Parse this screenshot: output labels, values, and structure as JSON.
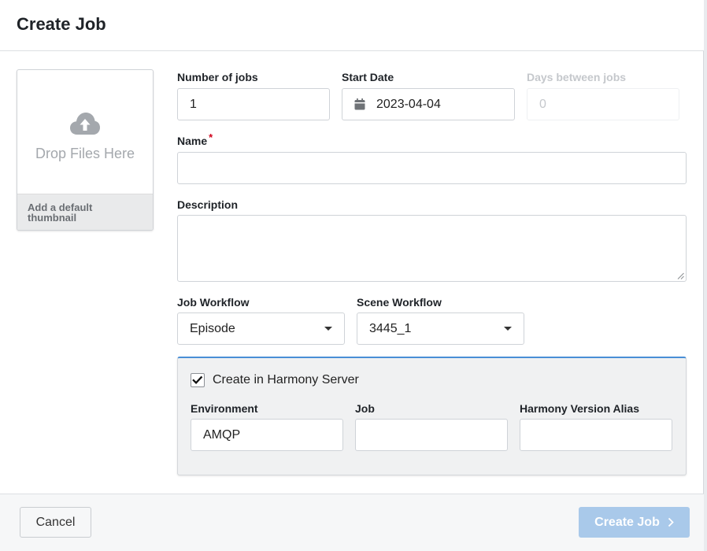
{
  "dialog": {
    "title": "Create Job"
  },
  "thumbnail": {
    "drop_text": "Drop Files Here",
    "default_label": "Add a default thumbnail"
  },
  "form": {
    "num_jobs": {
      "label": "Number of jobs",
      "value": "1"
    },
    "start_date": {
      "label": "Start Date",
      "value": "2023-04-04"
    },
    "days_between": {
      "label": "Days between jobs",
      "placeholder": "0"
    },
    "name": {
      "label": "Name",
      "required_mark": "*",
      "value": ""
    },
    "description": {
      "label": "Description",
      "value": ""
    },
    "job_workflow": {
      "label": "Job Workflow",
      "value": "Episode"
    },
    "scene_workflow": {
      "label": "Scene Workflow",
      "value": "3445_1"
    }
  },
  "harmony": {
    "checkbox_label": "Create in Harmony Server",
    "checked": true,
    "environment": {
      "label": "Environment",
      "value": "AMQP"
    },
    "job": {
      "label": "Job",
      "value": ""
    },
    "version_alias": {
      "label": "Harmony Version Alias",
      "value": ""
    }
  },
  "footer": {
    "cancel_label": "Cancel",
    "create_label": "Create Job"
  },
  "colors": {
    "accent_border": "#4a8fd6",
    "primary_disabled": "#a9c9ea",
    "required": "#d0021b"
  }
}
